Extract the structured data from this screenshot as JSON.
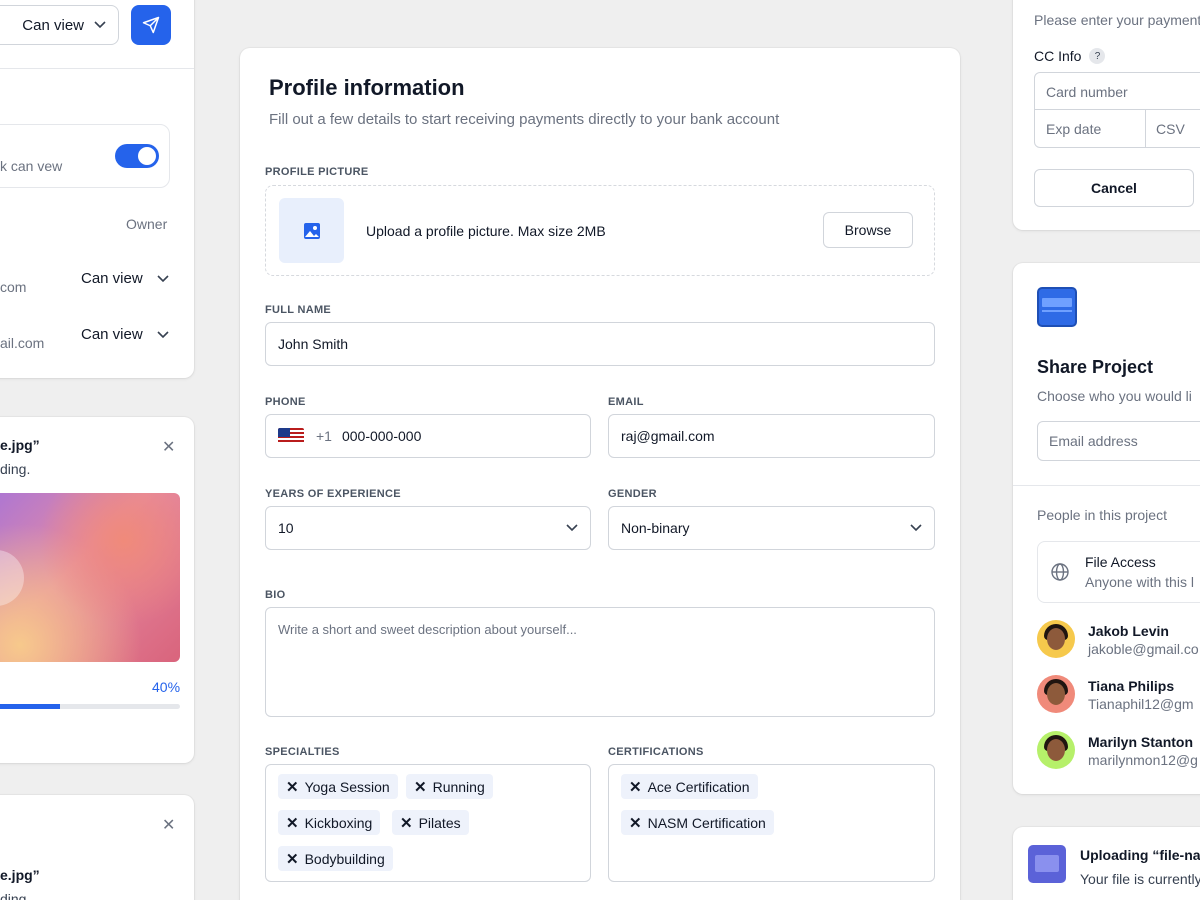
{
  "left_share": {
    "permission_dropdown": "Can view",
    "link_text": "k can vew",
    "owner_label": "Owner",
    "members": [
      {
        "email": "com",
        "permission": "Can view"
      },
      {
        "email": "ail.com",
        "permission": "Can view"
      }
    ]
  },
  "left_upload_1": {
    "filename": "e.jpg”",
    "status": "ding.",
    "progress_label": "40%",
    "progress": 0.4
  },
  "left_upload_2": {
    "filename": "e.jpg”",
    "status": "ding"
  },
  "profile": {
    "title": "Profile information",
    "subtitle": "Fill out a few details to start receiving payments directly to your bank account",
    "picture": {
      "label": "PROFILE PICTURE",
      "hint": "Upload a profile picture. Max size 2MB",
      "browse_label": "Browse"
    },
    "full_name": {
      "label": "FULL NAME",
      "value": "John Smith"
    },
    "phone": {
      "label": "PHONE",
      "prefix": "+1",
      "value": "000-000-000"
    },
    "email": {
      "label": "EMAIL",
      "value": "raj@gmail.com"
    },
    "experience": {
      "label": "YEARS OF EXPERIENCE",
      "value": "10"
    },
    "gender": {
      "label": "GENDER",
      "value": "Non-binary"
    },
    "bio": {
      "label": "BIO",
      "placeholder": "Write a short and sweet description about yourself..."
    },
    "specialties": {
      "label": "SPECIALTIES",
      "tags": [
        "Yoga Session",
        "Running",
        "Kickboxing",
        "Pilates",
        "Bodybuilding"
      ]
    },
    "certifications": {
      "label": "CERTIFICATIONS",
      "tags": [
        "Ace Certification",
        "NASM Certification"
      ]
    }
  },
  "payment": {
    "subtitle": "Please enter your payment",
    "cc_label": "CC Info",
    "help": "?",
    "card_placeholder": "Card number",
    "exp_placeholder": "Exp date",
    "csv_placeholder": "CSV",
    "cancel_label": "Cancel"
  },
  "share_project": {
    "title": "Share Project",
    "subtitle": "Choose who you would li",
    "email_placeholder": "Email address",
    "people_label": "People in this project",
    "file_access": {
      "title": "File Access",
      "desc": "Anyone with this l"
    },
    "people": [
      {
        "name": "Jakob Levin",
        "email": "jakoble@gmail.co",
        "bg": "#f6c94c"
      },
      {
        "name": "Tiana Philips",
        "email": "Tianaphil12@gm",
        "bg": "#f08a7a"
      },
      {
        "name": "Marilyn Stanton",
        "email": "marilynmon12@g",
        "bg": "#b6f06a"
      }
    ]
  },
  "upload_toast": {
    "title": "Uploading “file-nam",
    "desc": "Your file is currently"
  },
  "colors": {
    "accent": "#2563eb",
    "tag_bg": "#eef2fb"
  }
}
